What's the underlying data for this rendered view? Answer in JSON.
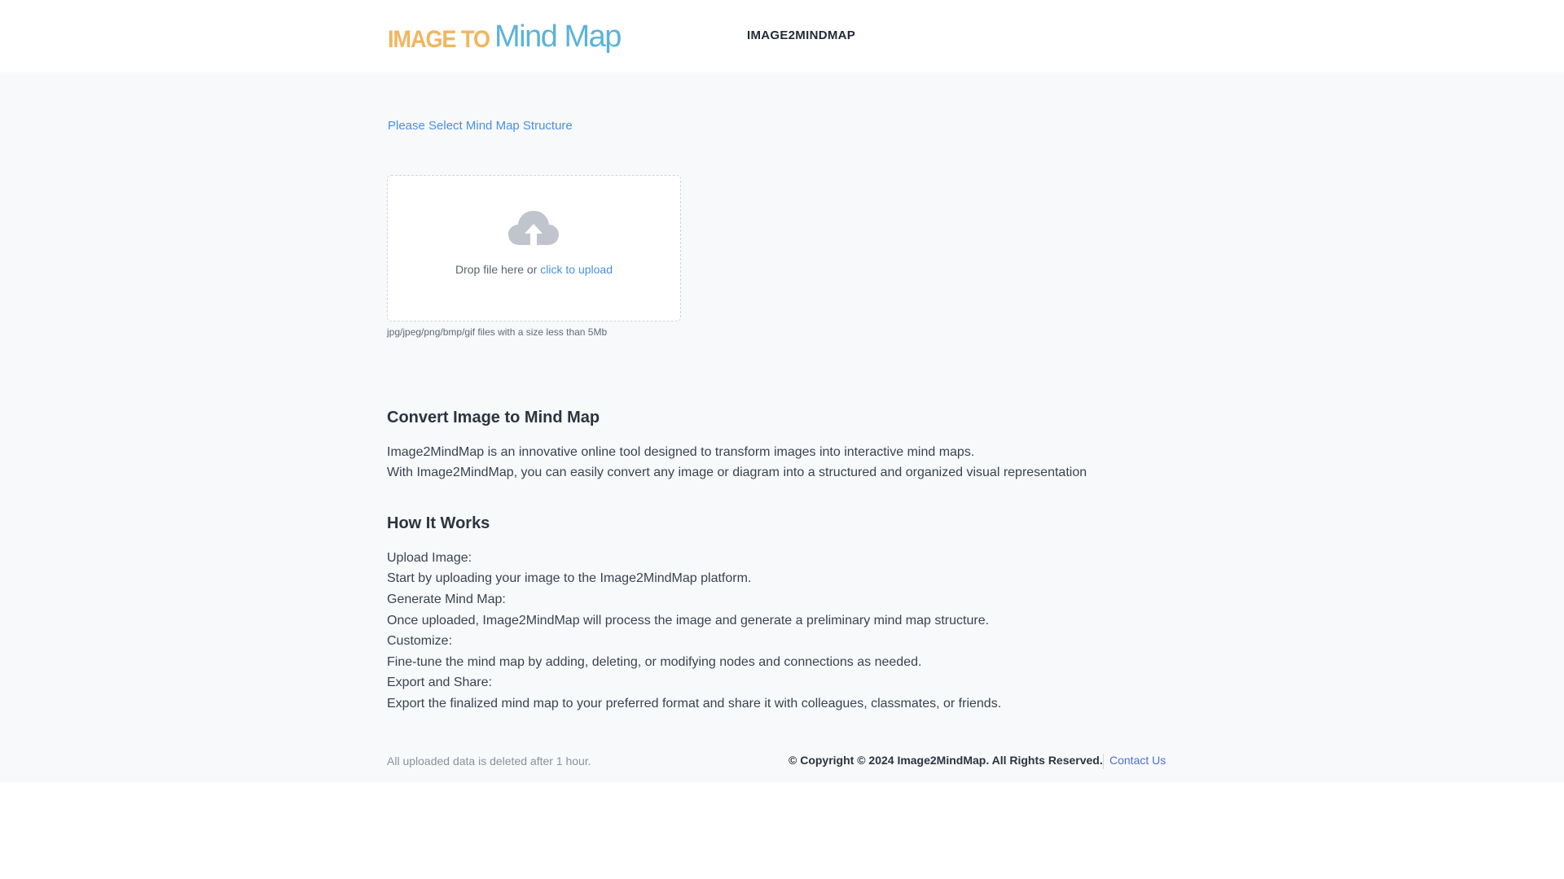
{
  "header": {
    "logo_small": "IMAGE TO",
    "logo_big": "Mind Map",
    "nav_title": "IMAGE2MINDMAP"
  },
  "upload": {
    "structure_link": "Please Select Mind Map Structure",
    "drop_text": "Drop file here or ",
    "click_text": "click to upload",
    "tip": "jpg/jpeg/png/bmp/gif files with a size less than 5Mb",
    "icon": "cloud-upload-icon"
  },
  "intro": {
    "heading": "Convert Image to Mind Map",
    "lines": [
      "Image2MindMap is an innovative online tool designed to transform images into interactive mind maps.",
      "With Image2MindMap, you can easily convert any image or diagram into a structured and organized visual representation"
    ]
  },
  "how": {
    "heading": "How It Works",
    "lines": [
      "Upload Image:",
      "Start by uploading your image to the Image2MindMap platform.",
      "Generate Mind Map:",
      "Once uploaded, Image2MindMap will process the image and generate a preliminary mind map structure.",
      "Customize:",
      "Fine-tune the mind map by adding, deleting, or modifying nodes and connections as needed.",
      "Export and Share:",
      "Export the finalized mind map to your preferred format and share it with colleagues, classmates, or friends."
    ]
  },
  "footer": {
    "note": "All uploaded data is deleted after 1 hour.",
    "copyright": "© Copyright © 2024 Image2MindMap. All Rights Reserved.",
    "contact": "Contact Us"
  },
  "colors": {
    "accent": "#4a8fe2",
    "logo_orange": "#f0b660",
    "logo_blue": "#5bb3d8",
    "background": "#f8f9fb"
  }
}
